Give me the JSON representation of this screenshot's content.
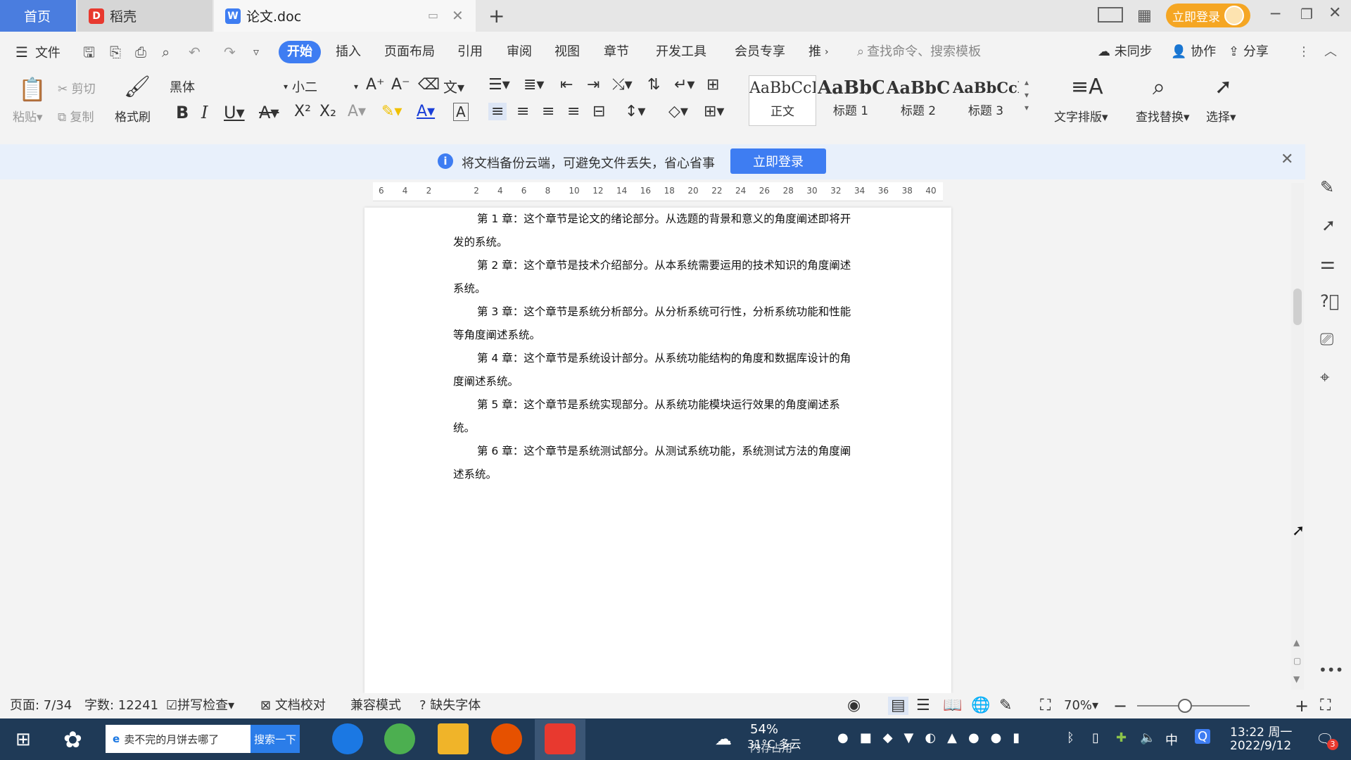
{
  "titlebar": {
    "tabs": [
      {
        "label": "首页"
      },
      {
        "label": "稻壳"
      },
      {
        "label": "论文.doc"
      }
    ],
    "login_button": "立即登录"
  },
  "menubar": {
    "file": "文件",
    "items": [
      "开始",
      "插入",
      "页面布局",
      "引用",
      "审阅",
      "视图",
      "章节",
      "开发工具",
      "会员专享",
      "推"
    ],
    "search_placeholder": "查找命令、搜索模板",
    "right": [
      "未同步",
      "协作",
      "分享"
    ]
  },
  "ribbon": {
    "paste": "粘贴",
    "cut": "剪切",
    "copy": "复制",
    "format_painter": "格式刷",
    "font_name": "黑体",
    "font_size": "小二",
    "styles": [
      {
        "sample": "AaBbCcI",
        "label": "正文"
      },
      {
        "sample": "AaBbC",
        "label": "标题 1"
      },
      {
        "sample": "AaBbC",
        "label": "标题 2"
      },
      {
        "sample": "AaBbCcl",
        "label": "标题 3"
      }
    ],
    "text_layout": "文字排版",
    "find_replace": "查找替换",
    "select": "选择"
  },
  "notice": {
    "text": "将文档备份云端，可避免文件丢失，省心省事",
    "button": "立即登录"
  },
  "ruler": {
    "ticks": [
      "6",
      "4",
      "2",
      "",
      "2",
      "4",
      "6",
      "8",
      "10",
      "12",
      "14",
      "16",
      "18",
      "20",
      "22",
      "24",
      "26",
      "28",
      "30",
      "32",
      "34",
      "36",
      "38",
      "40"
    ]
  },
  "document": {
    "paragraphs": [
      "第 1 章：这个章节是论文的绪论部分。从选题的背景和意义的角度阐述即将开发的系统。",
      "第 2 章：这个章节是技术介绍部分。从本系统需要运用的技术知识的角度阐述系统。",
      "第 3 章：这个章节是系统分析部分。从分析系统可行性，分析系统功能和性能等角度阐述系统。",
      "第 4 章：这个章节是系统设计部分。从系统功能结构的角度和数据库设计的角度阐述系统。",
      "第 5 章：这个章节是系统实现部分。从系统功能模块运行效果的角度阐述系统。",
      "第 6 章：这个章节是系统测试部分。从测试系统功能，系统测试方法的角度阐述系统。"
    ]
  },
  "statusbar": {
    "page": "页面: 7/34",
    "words": "字数: 12241",
    "spell": "拼写检查",
    "proof": "文档校对",
    "compat": "兼容模式",
    "missing_font": "缺失字体",
    "zoom": "70%"
  },
  "taskbar": {
    "search_text": "卖不完的月饼去哪了",
    "search_button": "搜索一下",
    "weather": "31°C 多云",
    "memory": "54%",
    "memory_label": "内存占用",
    "ime": "中",
    "time": "13:22 周一",
    "date": "2022/9/12",
    "notify_count": "3"
  },
  "colors": {
    "accent": "#3e7df2",
    "home_tab": "#4a7ddf",
    "login": "#f5a623",
    "taskbar": "#1f3a57",
    "notice_bg": "#e8f0fb"
  }
}
